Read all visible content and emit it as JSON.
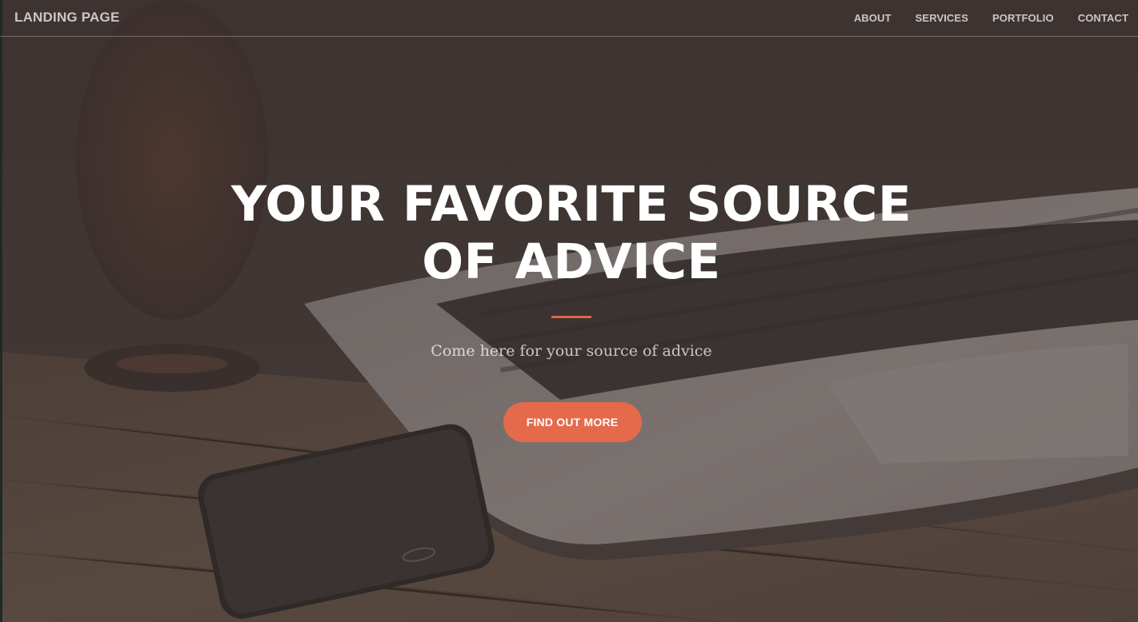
{
  "navbar": {
    "brand": "LANDING PAGE",
    "links": [
      {
        "label": "ABOUT"
      },
      {
        "label": "SERVICES"
      },
      {
        "label": "PORTFOLIO"
      },
      {
        "label": "CONTACT"
      }
    ]
  },
  "hero": {
    "title": "YOUR FAVORITE SOURCE OF ADVICE",
    "subtitle": "Come here for your source of advice",
    "button_label": "FIND OUT MORE"
  },
  "colors": {
    "accent": "#e46a4b",
    "overlay": "#4a3f3c",
    "text": "#ffffff"
  }
}
